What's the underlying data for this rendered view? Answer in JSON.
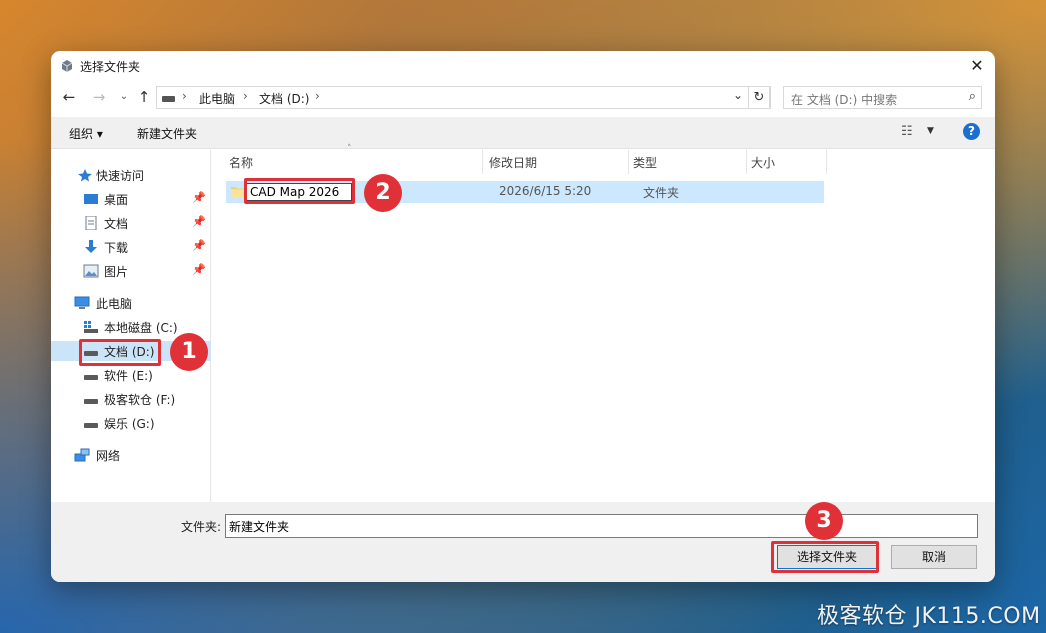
{
  "window": {
    "title": "选择文件夹",
    "close_label": "✕"
  },
  "address_bar": {
    "breadcrumbs": [
      "此电脑",
      "文档 (D:)"
    ],
    "search_placeholder": "在 文档 (D:) 中搜索"
  },
  "toolbar": {
    "organize_label": "组织 ▾",
    "new_folder_label": "新建文件夹",
    "help_label": "?"
  },
  "sidebar": {
    "quick_access": "快速访问",
    "quick_items": [
      "桌面",
      "文档",
      "下载",
      "图片"
    ],
    "this_pc": "此电脑",
    "drives": [
      "本地磁盘 (C:)",
      "文档 (D:)",
      "软件 (E:)",
      "极客软仓 (F:)",
      "娱乐 (G:)"
    ],
    "network": "网络",
    "selected": "文档 (D:)"
  },
  "columns": {
    "name": "名称",
    "modified": "修改日期",
    "type": "类型",
    "size": "大小"
  },
  "files": [
    {
      "name": "CAD Map 2026",
      "modified": "2026/6/15 5:20",
      "type": "文件夹",
      "size": ""
    }
  ],
  "footer": {
    "folder_label": "文件夹:",
    "folder_value": "新建文件夹",
    "select_button": "选择文件夹",
    "cancel_button": "取消"
  },
  "annotations": {
    "step1": "1",
    "step2": "2",
    "step3": "3",
    "accent_color": "#e03038"
  },
  "watermark": "极客软仓 JK115.COM",
  "colors": {
    "selection": "#cce8ff",
    "primary_border": "#0078d7",
    "help": "#1b6fd1"
  }
}
